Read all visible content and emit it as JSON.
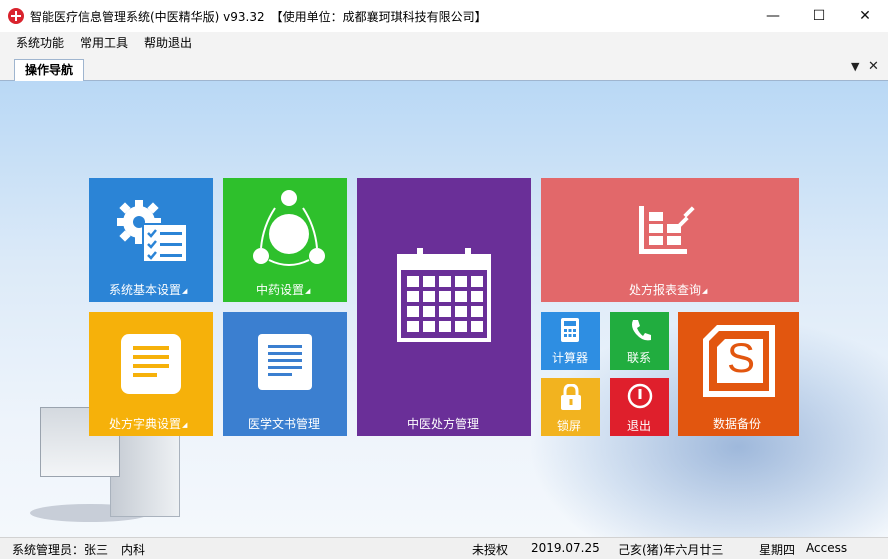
{
  "window": {
    "title": "智能医疗信息管理系统(中医精华版) v93.32　【使用单位：成都襄珂琪科技有限公司】",
    "min": "—",
    "max": "☐",
    "close": "✕"
  },
  "menu": [
    "系统功能",
    "常用工具",
    "帮助退出"
  ],
  "tab": {
    "label": "操作导航",
    "dropdown": "▼",
    "close": "✕"
  },
  "tiles": {
    "sys": {
      "label": "系统基本设置",
      "color": "#2b84d6",
      "icon": "gear-settings-icon"
    },
    "herb": {
      "label": "中药设置",
      "color": "#2ec02c",
      "icon": "network-nodes-icon"
    },
    "rx": {
      "label": "中医处方管理",
      "color": "#6a2f98",
      "icon": "calendar-grid-icon"
    },
    "report": {
      "label": "处方报表查询",
      "color": "#e2686a",
      "icon": "bar-chart-icon"
    },
    "dict": {
      "label": "处方字典设置",
      "color": "#f6b10a",
      "icon": "document-icon"
    },
    "doc": {
      "label": "医学文书管理",
      "color": "#3b7fd0",
      "icon": "document-lines-icon"
    },
    "calc": {
      "label": "计算器",
      "color": "#2e8ee2",
      "icon": "calculator-icon"
    },
    "contact": {
      "label": "联系",
      "color": "#21ad3f",
      "icon": "phone-icon"
    },
    "backup": {
      "label": "数据备份",
      "color": "#e2560f",
      "icon": "sway-logo-icon",
      "glyph": "S"
    },
    "lock": {
      "label": "锁屏",
      "color": "#f2b31f",
      "icon": "padlock-icon"
    },
    "exit": {
      "label": "退出",
      "color": "#df1f2c",
      "icon": "power-icon"
    }
  },
  "tile_arrow": "◢",
  "status": {
    "user": "系统管理员：张三",
    "dept": "内科",
    "license": "未授权",
    "date": "2019.07.25",
    "lunar": "己亥(猪)年六月廿三",
    "weekday": "星期四",
    "db": "Access"
  }
}
